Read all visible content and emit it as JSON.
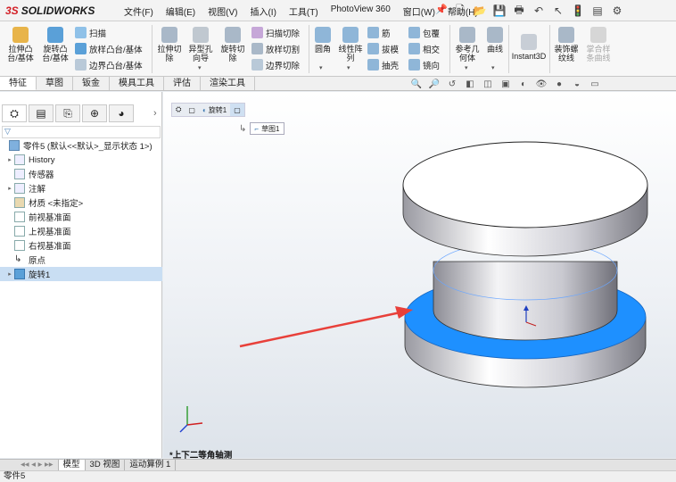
{
  "app": {
    "brand_prefix": "3S",
    "brand": "SOLIDWORKS"
  },
  "menubar": [
    "文件(F)",
    "编辑(E)",
    "视图(V)",
    "插入(I)",
    "工具(T)",
    "PhotoView 360",
    "窗口(W)",
    "帮助(H)"
  ],
  "ribbon": {
    "buttons": [
      {
        "name": "extrude-boss",
        "label": "拉伸凸\n台/基体"
      },
      {
        "name": "revolve-boss",
        "label": "旋转凸\n台/基体"
      },
      {
        "name": "sweep",
        "label": "扫描"
      },
      {
        "name": "loft",
        "label": "放样凸台/基体"
      },
      {
        "name": "boundary",
        "label": "边界凸台/基体"
      },
      {
        "name": "extrude-cut",
        "label": "拉伸切\n除"
      },
      {
        "name": "hole-wizard",
        "label": "异型孔\n向导"
      },
      {
        "name": "revolve-cut",
        "label": "旋转切\n除"
      },
      {
        "name": "swept-cut",
        "label": "扫描切除"
      },
      {
        "name": "lofted-cut",
        "label": "放样切割"
      },
      {
        "name": "boundary-cut",
        "label": "边界切除"
      },
      {
        "name": "fillet",
        "label": "圆角"
      },
      {
        "name": "linear-pattern",
        "label": "线性阵\n列"
      },
      {
        "name": "rib",
        "label": "筋"
      },
      {
        "name": "draft",
        "label": "拔模"
      },
      {
        "name": "shell",
        "label": "抽壳"
      },
      {
        "name": "wrap",
        "label": "包覆"
      },
      {
        "name": "intersect",
        "label": "相交"
      },
      {
        "name": "mirror",
        "label": "镜向"
      },
      {
        "name": "reference-geometry",
        "label": "参考几\n何体"
      },
      {
        "name": "curves",
        "label": "曲线"
      },
      {
        "name": "instant3d",
        "label": "Instant3D"
      },
      {
        "name": "thread",
        "label": "装饰螺\n纹线"
      },
      {
        "name": "split-line",
        "label": "掌合样\n条曲线"
      }
    ]
  },
  "tabs": [
    "特征",
    "草图",
    "钣金",
    "模具工具",
    "评估",
    "渲染工具"
  ],
  "active_tab": "特征",
  "tree": {
    "root": "零件5 (默认<<默认>_显示状态 1>)",
    "items": [
      {
        "label": "History",
        "expandable": true
      },
      {
        "label": "传感器",
        "expandable": false
      },
      {
        "label": "注解",
        "expandable": true
      },
      {
        "label": "材质 <未指定>",
        "expandable": false
      },
      {
        "label": "前视基准面",
        "expandable": false
      },
      {
        "label": "上视基准面",
        "expandable": false
      },
      {
        "label": "右视基准面",
        "expandable": false
      },
      {
        "label": "原点",
        "expandable": false
      },
      {
        "label": "旋转1",
        "expandable": true,
        "selected": true
      }
    ]
  },
  "breadcrumb": {
    "feature": "旋转1",
    "sketch": "草图1"
  },
  "view_orientation": "*上下二等角轴测",
  "bottom_tabs": [
    "模型",
    "3D 视图",
    "运动算例 1"
  ],
  "active_bottom_tab": "模型",
  "status_text": "零件5",
  "colors": {
    "accent": "#d32027",
    "highlight_face": "#1e90ff",
    "arrow": "#e8403a",
    "selected_row": "#c9def3"
  }
}
